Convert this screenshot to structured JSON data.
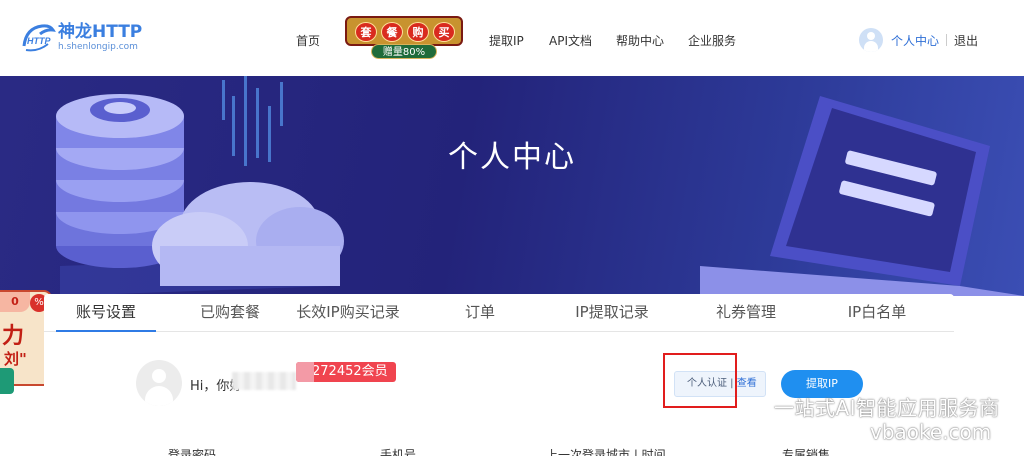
{
  "brand": {
    "name": "神龙HTTP",
    "domain": "h.shenlongip.com",
    "mark_text": "HTTP"
  },
  "nav": {
    "home": "首页",
    "extract_ip": "提取IP",
    "api_docs": "API文档",
    "help": "帮助中心",
    "enterprise": "企业服务",
    "user_center": "个人中心",
    "logout": "退出"
  },
  "promo": {
    "chars": [
      "套",
      "餐",
      "购",
      "买"
    ],
    "sub": "赠量80%"
  },
  "banner": {
    "title": "个人中心"
  },
  "tabs": [
    {
      "label": "账号设置",
      "active": true
    },
    {
      "label": "已购套餐",
      "active": false
    },
    {
      "label": "长效IP购买记录",
      "active": false
    },
    {
      "label": "订单",
      "active": false
    },
    {
      "label": "IP提取记录",
      "active": false
    },
    {
      "label": "礼券管理",
      "active": false
    },
    {
      "label": "IP白名单",
      "active": false
    }
  ],
  "profile": {
    "greeting": "Hi，你好",
    "member": "272452会员",
    "verify": "个人认证",
    "view": "查看",
    "extract_button": "提取IP"
  },
  "info_labels": [
    "登录密码",
    "手机号",
    "上一次登录城市 | 时间",
    "专属销售"
  ],
  "watermark": {
    "line1": "一站式AI智能应用服务商",
    "line2": "vbaoke.com"
  },
  "float_promo": {
    "percent": "0",
    "pct_sign": "%",
    "big": "力",
    "small": "刘\""
  },
  "colors": {
    "accent": "#2f7be5",
    "badge": "#f0444f",
    "banner": "#23237a",
    "highlight": "#e11d1d"
  }
}
